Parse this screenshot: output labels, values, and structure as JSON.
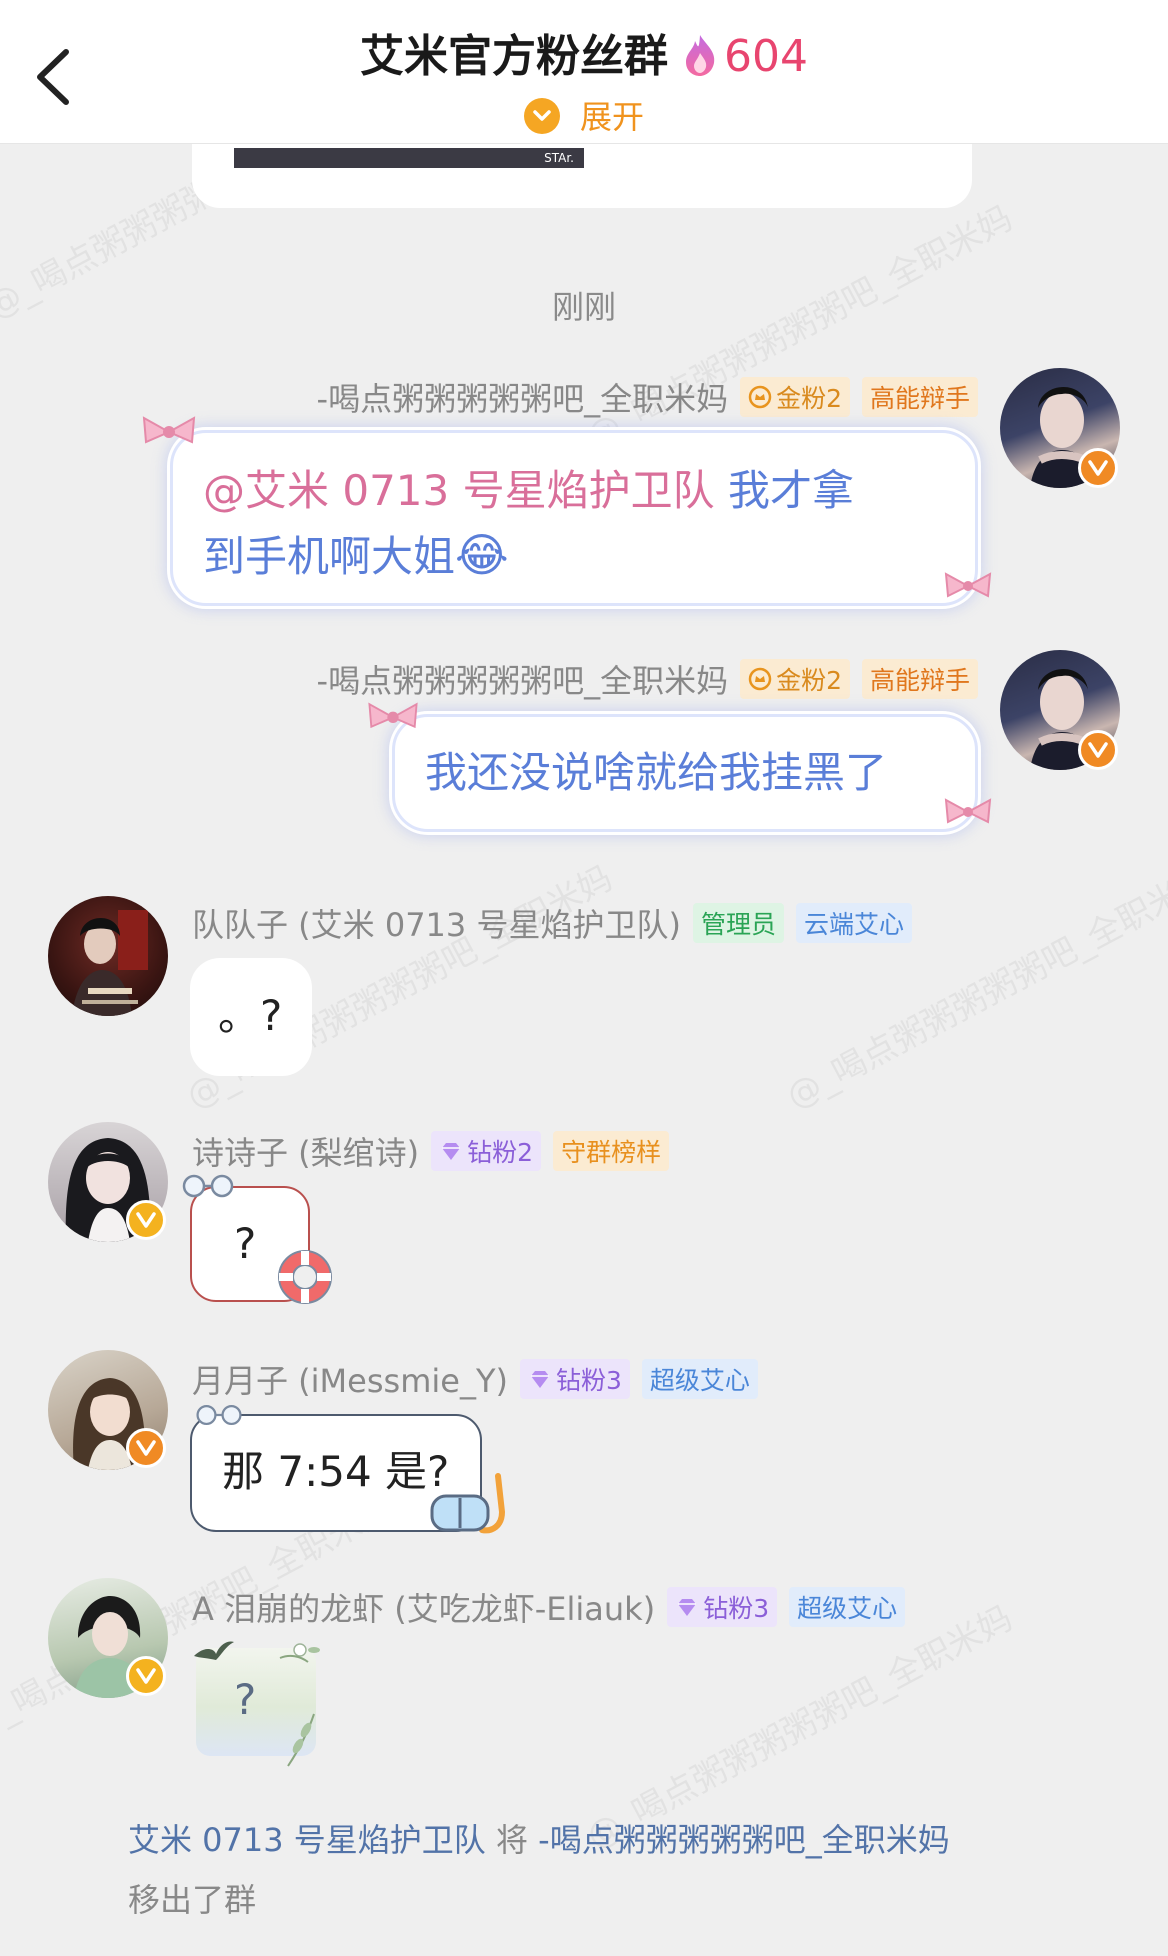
{
  "header": {
    "title": "艾米官方粉丝群",
    "count": "604",
    "expand_label": "展开"
  },
  "prev_card": {
    "caption": "STAr."
  },
  "time_label": "刚刚",
  "watermark": "@_喝点粥粥粥粥粥吧_全职米妈",
  "messages": [
    {
      "side": "right",
      "sender": "-喝点粥粥粥粥粥吧_全职米妈",
      "badges": [
        {
          "label": "金粉2",
          "style": "gold",
          "icon": "crown-icon"
        },
        {
          "label": "高能辩手",
          "style": "orange"
        }
      ],
      "mention": "@艾米 0713 号星焰护卫队",
      "text_line1": " 我才拿",
      "text_line2": "到手机啊大姐",
      "emoji": "😂"
    },
    {
      "side": "right",
      "sender": "-喝点粥粥粥粥粥吧_全职米妈",
      "badges": [
        {
          "label": "金粉2",
          "style": "gold",
          "icon": "crown-icon"
        },
        {
          "label": "高能辩手",
          "style": "orange"
        }
      ],
      "text": "我还没说啥就给我挂黑了"
    },
    {
      "side": "left",
      "sender": "队队子 (艾米 0713 号星焰护卫队)",
      "badges": [
        {
          "label": "管理员",
          "style": "green"
        },
        {
          "label": "云端艾心",
          "style": "blue"
        }
      ],
      "text": "。?"
    },
    {
      "side": "left",
      "sender": "诗诗子 (梨绾诗)",
      "badges": [
        {
          "label": "钻粉2",
          "style": "purple",
          "icon": "diamond-icon"
        },
        {
          "label": "守群榜样",
          "style": "yellow"
        }
      ],
      "text": "?"
    },
    {
      "side": "left",
      "sender": "月月子 (iMessmie_Y)",
      "badges": [
        {
          "label": "钻粉3",
          "style": "purple",
          "icon": "diamond-icon"
        },
        {
          "label": "超级艾心",
          "style": "blue"
        }
      ],
      "text": "那 7:54 是?"
    },
    {
      "side": "left",
      "sender": "A 泪崩的龙虾 (艾吃龙虾-Eliauk)",
      "badges": [
        {
          "label": "钻粉3",
          "style": "purple",
          "icon": "diamond-icon"
        },
        {
          "label": "超级艾心",
          "style": "blue"
        }
      ],
      "text": "?"
    }
  ],
  "system": {
    "actor": "艾米 0713 号星焰护卫队",
    "verb": " 将 ",
    "target": "-喝点粥粥粥粥粥吧_全职米妈",
    "result": "移出了群"
  },
  "colors": {
    "accent_orange": "#f0931e",
    "count_pink": "#e8456f",
    "mention_pink": "#d96f9a",
    "bubble_text_blue": "#5a7ed8",
    "system_link": "#5273a8"
  }
}
